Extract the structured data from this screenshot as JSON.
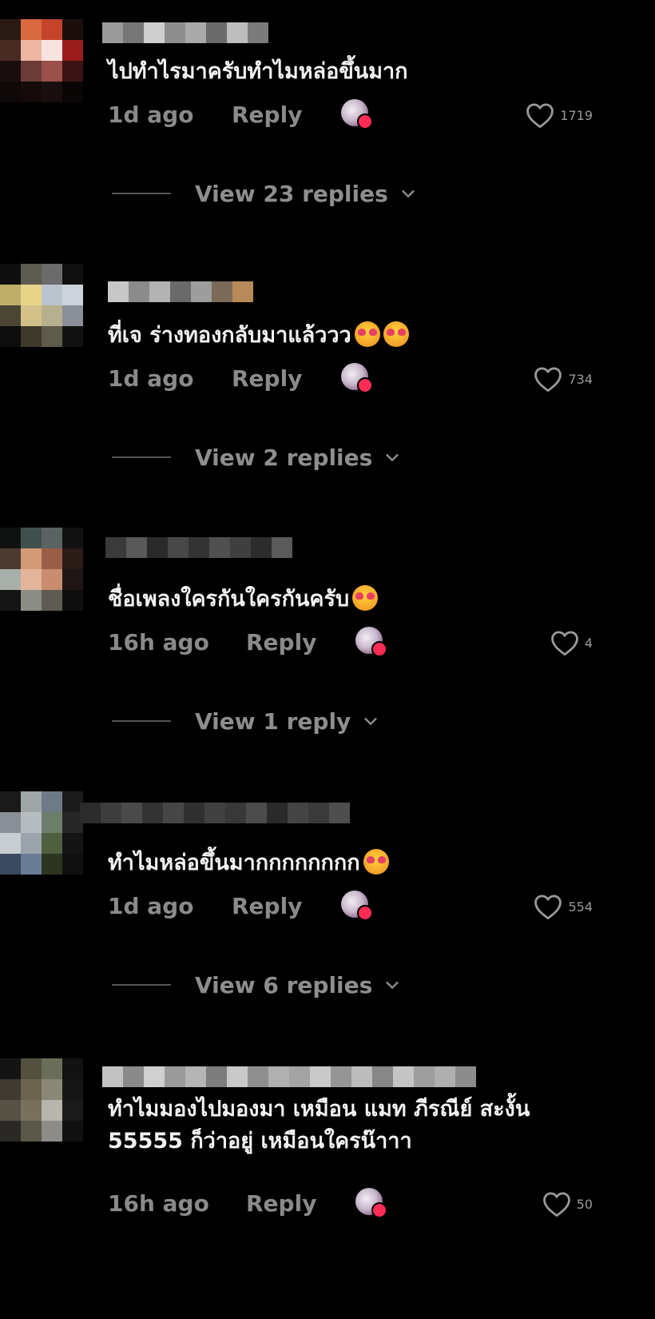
{
  "comments": [
    {
      "text": "ไปทำไรมาครับทำไมหล่อขึ้นมาก",
      "emojis": [],
      "time": "1d ago",
      "reply_label": "Reply",
      "likes": "1719",
      "view_replies": "View 23 replies",
      "avatar_colors": [
        "#2a1a14",
        "#d9693f",
        "#c4432a",
        "#1b0e0c",
        "#4a2b24",
        "#f0b6a4",
        "#f7e4e0",
        "#9b1c1c",
        "#1a0d0d",
        "#6b3b38",
        "#9a5048",
        "#3a1414",
        "#0f0808",
        "#140a0a",
        "#1a0f0f",
        "#0a0606"
      ],
      "name_colors": [
        "#9a9a9a",
        "#777",
        "#cfcfcf",
        "#8e8e8e",
        "#a9a9a9",
        "#6a6a6a",
        "#bdbdbd",
        "#7b7b7b"
      ]
    },
    {
      "text": "ที่เจ ร่างทองกลับมาแล้ววว",
      "emojis": [
        "smiling-face-with-hearts",
        "smiling-face-with-hearts"
      ],
      "time": "1d ago",
      "reply_label": "Reply",
      "likes": "734",
      "view_replies": "View 2 replies",
      "avatar_colors": [
        "#0e0e0e",
        "#5d5a4f",
        "#6b6b6b",
        "#101010",
        "#bfae6a",
        "#e6d489",
        "#b9c4ce",
        "#cdd2dc",
        "#4a4633",
        "#d2c28a",
        "#b7b08f",
        "#8a8f99",
        "#0d0d0d",
        "#3d3a2c",
        "#5f5b4a",
        "#121212"
      ],
      "name_colors": [
        "#c7c7c7",
        "#8b8b8b",
        "#b3b3b3",
        "#6a6a6a",
        "#9d9d9d",
        "#7b6a58",
        "#b88a5a"
      ]
    },
    {
      "text": "ชื่อเพลงใครกันใครกันครับ",
      "emojis": [
        "smiling-face-with-hearts"
      ],
      "time": "16h ago",
      "reply_label": "Reply",
      "likes": "4",
      "view_replies": "View 1 reply",
      "avatar_colors": [
        "#101212",
        "#3f4f4e",
        "#5a6262",
        "#121212",
        "#4a3a30",
        "#d39a78",
        "#9a5e47",
        "#2b1c18",
        "#a8b0a9",
        "#e2b59a",
        "#c98c6f",
        "#1e1615",
        "#151515",
        "#8b8c86",
        "#5f5a54",
        "#0e0e0e"
      ],
      "name_colors": [
        "#3a3a3a",
        "#595959",
        "#2a2a2a",
        "#484848",
        "#333333",
        "#505050",
        "#3f3f3f",
        "#2c2c2c",
        "#5a5a5a"
      ]
    },
    {
      "text": "ทำไมหล่อขึ้นมากกกกกกกก",
      "emojis": [
        "smiling-face-with-hearts"
      ],
      "time": "1d ago",
      "reply_label": "Reply",
      "likes": "554",
      "view_replies": "View 6 replies",
      "avatar_colors": [
        "#1a1a1a",
        "#a0a6a8",
        "#6e7a86",
        "#1b1b1b",
        "#8a9097",
        "#b7bcc0",
        "#6b7e6a",
        "#262626",
        "#c8cdd2",
        "#9ba4ad",
        "#4f5f3f",
        "#141414",
        "#3c4a5f",
        "#6a7b96",
        "#2d3520",
        "#0f0f0f"
      ],
      "name_colors": [
        "#2c2c2c",
        "#3d3d3d",
        "#4a4a4a",
        "#333333",
        "#464646",
        "#2f2f2f",
        "#414141",
        "#383838",
        "#4c4c4c",
        "#2a2a2a",
        "#444444",
        "#3a3a3a",
        "#4e4e4e"
      ]
    },
    {
      "text": "ทำไมมองไปมองมา เหมือน แมท ภีรณีย์ สะงั้น\n55555 ก็ว่าอยู่ เหมือนใครน๊าาา",
      "emojis": [],
      "time": "16h ago",
      "reply_label": "Reply",
      "likes": "50",
      "view_replies": "",
      "avatar_colors": [
        "#141414",
        "#54503f",
        "#6a6d58",
        "#121212",
        "#3e3a31",
        "#6b634d",
        "#8a8775",
        "#151515",
        "#555145",
        "#76705c",
        "#b7b5ae",
        "#1a1a1a",
        "#2a2824",
        "#5a5648",
        "#8e8c86",
        "#101010"
      ],
      "name_colors": [
        "#c2c2c2",
        "#8a8a8a",
        "#d0d0d0",
        "#9a9a9a",
        "#b5b5b5",
        "#7d7d7d",
        "#c9c9c9",
        "#8f8f8f",
        "#b0b0b0",
        "#a3a3a3",
        "#cacaca",
        "#959595",
        "#bcbcbc",
        "#878787",
        "#c4c4c4",
        "#9e9e9e",
        "#afafaf",
        "#8c8c8c"
      ]
    }
  ],
  "colors": {
    "background": "#000000",
    "text": "#f2f2f2",
    "muted": "#8a8a8a",
    "creator_heart": "#fe2c55"
  }
}
